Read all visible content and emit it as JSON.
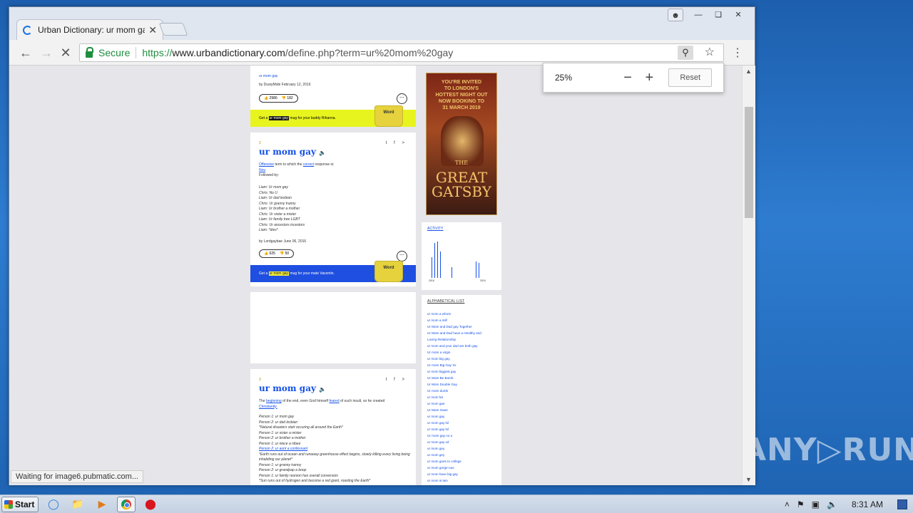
{
  "browser": {
    "tab_title": "Urban Dictionary: ur mom gay",
    "tab_close": "✕",
    "url_secure": "Secure",
    "url_scheme": "https://",
    "url_host": "www.urbandictionary.com",
    "url_path": "/define.php?term=ur%20mom%20gay",
    "status": "Waiting for image6.pubmatic.com..."
  },
  "zoom_popup": {
    "level": "25%",
    "minus": "−",
    "plus": "+",
    "reset": "Reset"
  },
  "entry1": {
    "top_text": "ur mom gay",
    "author_line": "by DustyMobi February 12, 2016",
    "votes_up": "2986",
    "votes_down": "182",
    "mug_text": "Get a",
    "mug_term": "ur mom gay",
    "mug_suffix": "mug for your buddy Rihanna.",
    "mug_label": "Word"
  },
  "entry2": {
    "number": "2",
    "title": "ur mom gay",
    "line1_a": "Offensive",
    "line1_b": " term to which the ",
    "line1_c": "correct",
    "line1_d": " response is:",
    "line2": "Nou",
    "line3": "Followed by:",
    "dialog": [
      "Liam: Ur mom gay",
      "Chris: No U",
      "Liam: Ur dad lesbian",
      "Chris: Ur granny tranny",
      "Liam: Ur brother a mother",
      "Chris: Ur sister a mister",
      "Liam: Ur family tree LGBT",
      "Chris: Ur ancestors incestors",
      "Liam: *dies*"
    ],
    "author_line": "by Lordgaybae June 06, 2016",
    "votes_up": "625",
    "votes_down": "50",
    "mug_text": "Get a",
    "mug_term": "ur mom gay",
    "mug_suffix": "mug for your mate Vacentin.",
    "mug_label": "Word"
  },
  "entry3": {
    "number": "3",
    "title": "ur mom gay",
    "intro_a": "The ",
    "intro_b": "beginning",
    "intro_c": " of the end, even God himself ",
    "intro_d": "feared",
    "intro_e": " of such insult, so he created",
    "intro_f": "Christianity.",
    "dialog": [
      "Person 1: ur mom gay",
      "Person 2: ur dad lesbian",
      "*Natural disasters start occuring all around the Earth*",
      "Person 1: ur sister a mister",
      "Person 2: ur brother a mother",
      "Person 1: ur niece a nibee",
      "Person 2: ur aunt a confessant",
      "*Earth runs out of ocean and runaway greenhouse effect begins, slowly killing every living being inhabiting our planet*",
      "Person 1: ur granny tranny",
      "Person 2: ur grandpap a boop",
      "Person 1: ur family reunion has overall conversion",
      "*Sun runs out of hydrogen and become a red giant, roasting the Earth*"
    ]
  },
  "share_icons": "t f >",
  "ad": {
    "line1": "YOU'RE INVITED",
    "line2": "TO LONDON'S",
    "line3": "HOTTEST NIGHT OUT",
    "line4": "NOW BOOKING TO",
    "line5": "31 MARCH 2019",
    "title_small": "THE",
    "title": "GREAT GATSBY"
  },
  "activity": {
    "title": "ACTIVITY",
    "tick_left": "2016",
    "tick_right": "2019",
    "bars": [
      0.55,
      0.95,
      0.98,
      0.72,
      0.28,
      0.45,
      0.4
    ]
  },
  "alphabetical": {
    "title": "ALPHABETICAL LIST",
    "items": [
      "ur mom a whore",
      "ur mom a milf",
      "Ur Mom and Dad gay Together",
      "Ur Mom and Dad have a Healthy and",
      "Loving Relationship",
      "ur mom and your dad are both gay",
      "Ur mom a virgin",
      "ur mom big gay",
      "Ur mom Big Gay Xx",
      "ur mom biggest gay",
      "Ur Mom Be Bomb",
      "Ur Mom Double Gay",
      "Ur mom dumb",
      "ur mom fat",
      "ur mom gae",
      "Ur Mom Gaee",
      "ur mom gay",
      "ur mom gay lol",
      "ur mom gay lol",
      "Ur mom gay no u",
      "ur mom gay xd",
      "ur mom gey",
      "ur mom gey",
      "ur mom goes to college",
      "ur mom gorge-ous",
      "ur mom have big gay",
      "ur mom is lam",
      "ur mom is overrated m20"
    ]
  },
  "taskbar": {
    "start": "Start",
    "time": "8:31 AM"
  },
  "watermark": "ANY▷RUN"
}
